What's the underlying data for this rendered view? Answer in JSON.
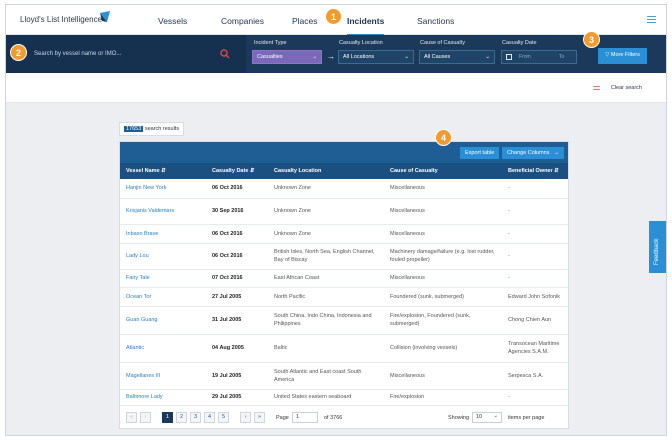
{
  "brand": {
    "logo_text": "Lloyd's List Intelligence"
  },
  "nav": {
    "items": [
      "Vessels",
      "Companies",
      "Places",
      "Incidents",
      "Sanctions"
    ],
    "active": "Incidents"
  },
  "filters": {
    "search_placeholder": "Search by vessel name or IMO...",
    "incident_type_label": "Incident Type",
    "incident_type_value": "Casualties",
    "casualty_location_label": "Casualty Location",
    "casualty_location_value": "All Locations",
    "cause_label": "Cause of Casualty",
    "cause_value": "All Causes",
    "date_label": "Casualty Date",
    "date_from": "From",
    "date_to": "To",
    "more_filters": "More Filters",
    "clear_search": "Clear search"
  },
  "results": {
    "count": "17653",
    "suffix": "search results"
  },
  "table_actions": {
    "export": "Export table",
    "columns": "Change Columns"
  },
  "table": {
    "headers": [
      "Vessel Name",
      "Casualty Date",
      "Casualty Location",
      "Cause of Casualty",
      "Beneficial Owner"
    ],
    "rows": [
      [
        "Hanjin New York",
        "06 Oct 2016",
        "Unknown Zone",
        "Miscellaneous",
        "-"
      ],
      [
        "Krisjanis Valdemars",
        "30 Sep 2016",
        "Unknown Zone",
        "Miscellaneous",
        "-"
      ],
      [
        "Inbaso Brave",
        "06 Oct 2016",
        "Unknown Zone",
        "Miscellaneous",
        "-"
      ],
      [
        "Lady Lou",
        "06 Oct 2016",
        "British Isles, North Sea, English Channel, Bay of Biscay",
        "Machinery damage/failure (e.g. lost rudder, fouled propeller)",
        "-"
      ],
      [
        "Fairy Tale",
        "07 Oct 2016",
        "East African Coast",
        "Miscellaneous",
        "-"
      ],
      [
        "Ocean Tor",
        "27 Jul 2005",
        "North Pacific",
        "Foundered (sunk, submerged)",
        "Edward John Sofonik"
      ],
      [
        "Guan Guang",
        "31 Jul 2005",
        "South China, Indo China, Indonesia and Philippines",
        "Fire/explosion, Foundered (sunk, submerged)",
        "Chong Chien Aun"
      ],
      [
        "Atlantic",
        "04 Aug 2005",
        "Baltic",
        "Collision (involving vessels)",
        "Transocean Maritime Agencies S.A.M."
      ],
      [
        "Magellanes III",
        "19 Jul 2005",
        "South Atlantic and East coast South America",
        "Miscellaneous",
        "Serpesca S.A."
      ],
      [
        "Baltimore Lady",
        "29 Jul 2005",
        "United States eastern seaboard",
        "Fire/explosion",
        "-"
      ]
    ]
  },
  "pagination": {
    "pages": [
      "1",
      "2",
      "3",
      "4",
      "5"
    ],
    "current": "1",
    "page_label": "Page",
    "page_value": "1",
    "of_label": "of 3766",
    "showing_label": "Showing",
    "showing_value": "10",
    "per_page_label": "items per page"
  },
  "feedback": "Feedback",
  "callouts": [
    "1",
    "2",
    "3",
    "4"
  ],
  "colors": {
    "navy": "#1b3a5b",
    "accent": "#2a8fd4",
    "callout": "#f29a2e"
  }
}
